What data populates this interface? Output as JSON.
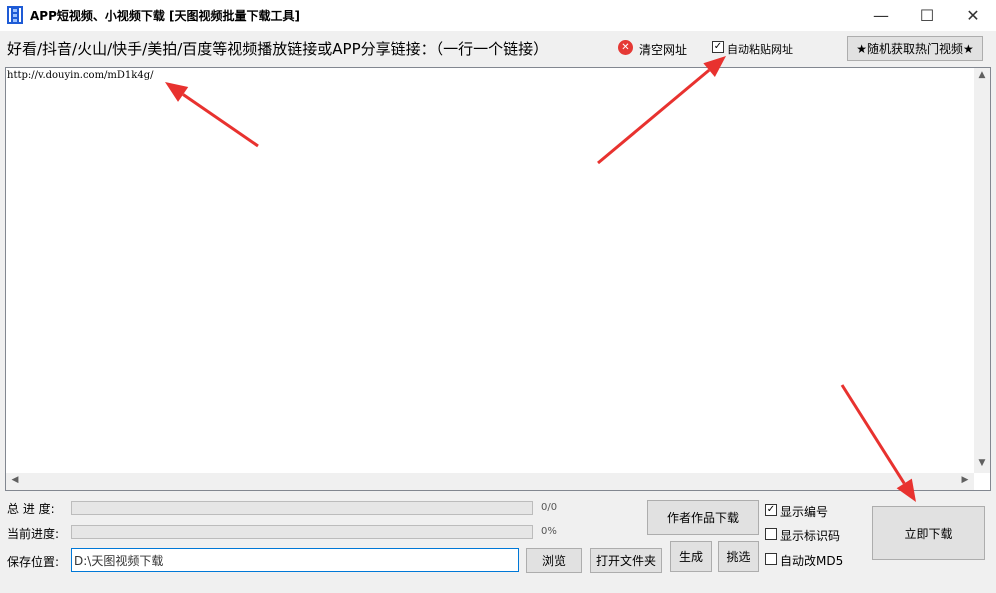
{
  "window": {
    "title": "APP短视频、小视频下载 [天图视频批量下载工具]",
    "minimize": "—",
    "maximize": "☐",
    "close": "✕"
  },
  "header": {
    "instruction": "好看/抖音/火山/快手/美拍/百度等视频播放链接或APP分享链接：（一行一个链接）",
    "clear_url_label": "清空网址",
    "auto_paste_label": "自动粘贴网址",
    "auto_paste_checked": true,
    "random_hot_button": "★随机获取热门视频★"
  },
  "links": {
    "content": "http://v.douyin.com/mD1k4g/"
  },
  "progress": {
    "total_label": "总 进 度:",
    "total_value": 0,
    "total_text": "0/0",
    "current_label": "当前进度:",
    "current_value": 0,
    "current_text": "0%"
  },
  "save": {
    "label": "保存位置:",
    "path": "D:\\天图视频下载"
  },
  "buttons": {
    "browse": "浏览",
    "open_folder": "打开文件夹",
    "author_works": "作者作品下载",
    "generate": "生成",
    "select": "挑选",
    "download_now": "立即下载"
  },
  "options": {
    "show_number": {
      "label": "显示编号",
      "checked": true
    },
    "show_id": {
      "label": "显示标识码",
      "checked": false
    },
    "auto_md5": {
      "label": "自动改MD5",
      "checked": false
    }
  },
  "colors": {
    "annotation_arrow": "#e8322f",
    "focus_border": "#0078d7"
  }
}
